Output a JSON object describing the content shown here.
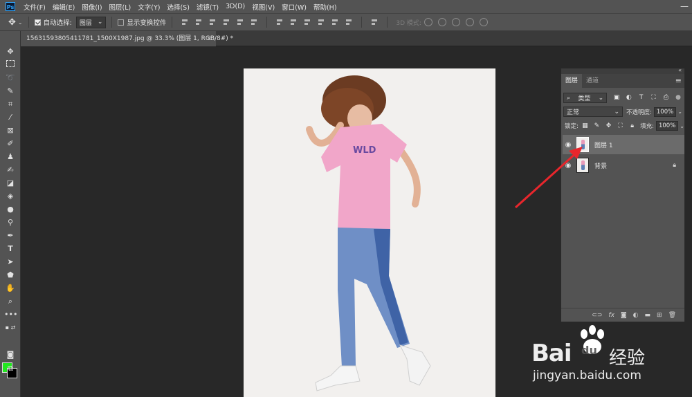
{
  "app": {
    "logo": "Ps"
  },
  "menu": [
    "文件(F)",
    "编辑(E)",
    "图像(I)",
    "图层(L)",
    "文字(Y)",
    "选择(S)",
    "滤镜(T)",
    "3D(D)",
    "视图(V)",
    "窗口(W)",
    "帮助(H)"
  ],
  "options": {
    "auto_select_label": "自动选择:",
    "auto_select_checked": true,
    "auto_select_target": "图层",
    "show_transform_label": "显示变换控件",
    "show_transform_checked": false,
    "mode_3d_label": "3D 模式:"
  },
  "document": {
    "tab_title": "15631593805411781_1500X1987.jpg @ 33.3% (图层 1, RGB/8#) *",
    "close": "×"
  },
  "colors": {
    "foreground": "#22e51f",
    "background": "#000000",
    "arrow": "#e8262c"
  },
  "layers_panel": {
    "tabs": [
      "图层",
      "通道"
    ],
    "active_tab": "图层",
    "filter_kind": "类型",
    "blend_mode": "正常",
    "opacity_label": "不透明度:",
    "opacity_value": "100%",
    "lock_label": "锁定:",
    "fill_label": "填充:",
    "fill_value": "100%",
    "layers": [
      {
        "name": "图层 1",
        "visible": true,
        "selected": true,
        "locked": false
      },
      {
        "name": "背景",
        "visible": true,
        "selected": false,
        "locked": true
      }
    ]
  },
  "watermark": {
    "brand": "Bai",
    "brand2": "du",
    "suffix": "经验",
    "url": "jingyan.baidu.com"
  }
}
